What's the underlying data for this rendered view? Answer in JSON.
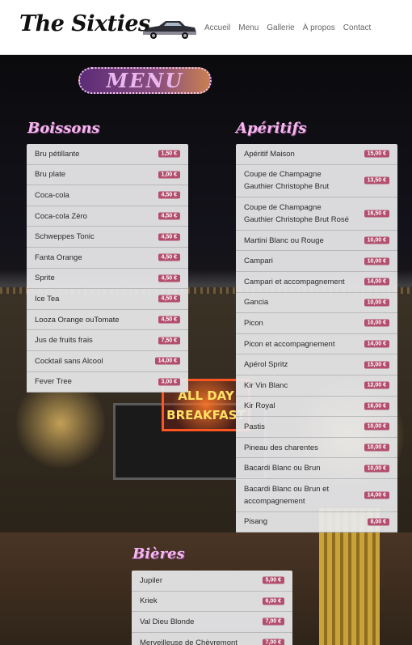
{
  "brand": {
    "name": "The Sixties"
  },
  "nav": {
    "links": [
      "Accueil",
      "Menu",
      "Gallerie",
      "À propos",
      "Contact"
    ]
  },
  "background": {
    "sign_text": "ALL DAY BREAKFAST"
  },
  "banner": {
    "text": "MENU"
  },
  "boissons": {
    "title": "Boissons",
    "items": [
      {
        "name": "Bru pétillante",
        "price": "1,50 €"
      },
      {
        "name": "Bru plate",
        "price": "1,00 €"
      },
      {
        "name": "Coca-cola",
        "price": "4,50 €"
      },
      {
        "name": "Coca-cola Zéro",
        "price": "4,50 €"
      },
      {
        "name": "Schweppes Tonic",
        "price": "4,50 €"
      },
      {
        "name": "Fanta Orange",
        "price": "4,50 €"
      },
      {
        "name": "Sprite",
        "price": "4,50 €"
      },
      {
        "name": "Ice Tea",
        "price": "4,50 €"
      },
      {
        "name": "Looza Orange ouTomate",
        "price": "4,50 €"
      },
      {
        "name": "Jus de fruits frais",
        "price": "7,50 €"
      },
      {
        "name": "Cocktail sans Alcool",
        "price": "14,00 €"
      },
      {
        "name": "Fever Tree",
        "price": "3,00 €"
      }
    ]
  },
  "aperitifs": {
    "title": "Apéritifs",
    "items": [
      {
        "name": "Apéritif Maison",
        "price": "15,00 €"
      },
      {
        "name": "Coupe de Champagne Gauthier Christophe Brut",
        "price": "13,50 €"
      },
      {
        "name": "Coupe de Champagne Gauthier Christophe Brut Rosé",
        "price": "16,50 €"
      },
      {
        "name": "Martini Blanc ou Rouge",
        "price": "10,00 €"
      },
      {
        "name": "Campari",
        "price": "10,00 €"
      },
      {
        "name": "Campari et accompagnement",
        "price": "14,00 €"
      },
      {
        "name": "Gancia",
        "price": "10,00 €"
      },
      {
        "name": "Picon",
        "price": "10,00 €"
      },
      {
        "name": "Picon et accompagnement",
        "price": "14,00 €"
      },
      {
        "name": "Apérol Spritz",
        "price": "15,00 €"
      },
      {
        "name": "Kir Vin Blanc",
        "price": "12,00 €"
      },
      {
        "name": "Kir Royal",
        "price": "16,00 €"
      },
      {
        "name": "Pastis",
        "price": "10,00 €"
      },
      {
        "name": "Pineau des charentes",
        "price": "10,00 €"
      },
      {
        "name": "Bacardi Blanc ou Brun",
        "price": "10,00 €"
      },
      {
        "name": "Bacardi Blanc ou Brun et accompagnement",
        "price": "14,00 €"
      },
      {
        "name": "Pisang",
        "price": "8,00 €"
      }
    ]
  },
  "bieres": {
    "title": "Bières",
    "items": [
      {
        "name": "Jupiler",
        "price": "5,00 €"
      },
      {
        "name": "Kriek",
        "price": "6,00 €"
      },
      {
        "name": "Val Dieu Blonde",
        "price": "7,00 €"
      },
      {
        "name": "Merveilleuse de Chèvremont",
        "price": "7,00 €"
      }
    ]
  },
  "colors": {
    "accent": "#b24f6e",
    "title_pink": "#f4b8ee"
  }
}
